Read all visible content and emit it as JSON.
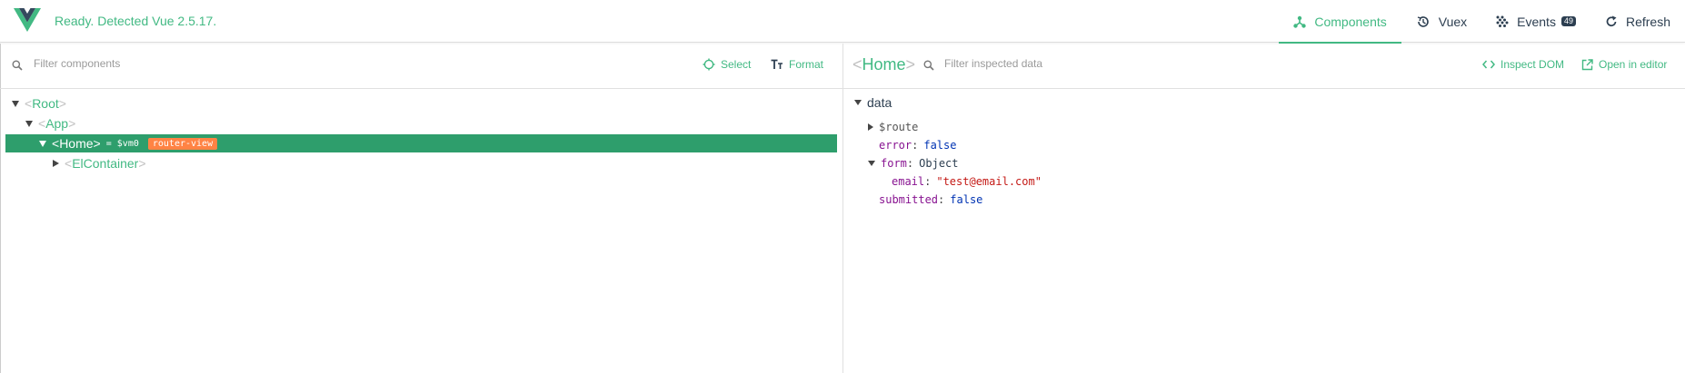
{
  "header": {
    "status": "Ready. Detected Vue 2.5.17.",
    "nav": {
      "components": "Components",
      "vuex": "Vuex",
      "events": "Events",
      "events_count": "49",
      "refresh": "Refresh"
    }
  },
  "left": {
    "filter_placeholder": "Filter components",
    "select_label": "Select",
    "format_label": "Format",
    "tree": {
      "root": "Root",
      "app": "App",
      "home": "Home",
      "home_vm": "= $vm0",
      "home_badge": "router-view",
      "container": "ElContainer"
    }
  },
  "right": {
    "title": "Home",
    "filter_placeholder": "Filter inspected data",
    "inspect_dom": "Inspect DOM",
    "open_editor": "Open in editor",
    "section": "data",
    "rows": {
      "route_key": "$route",
      "error_key": "error",
      "error_val": "false",
      "form_key": "form",
      "form_val": "Object",
      "email_key": "email",
      "email_val": "\"test@email.com\"",
      "submitted_key": "submitted",
      "submitted_val": "false"
    }
  },
  "colors": {
    "accent": "#42b983",
    "selected_row": "#2e9e6c",
    "badge": "#ff8344"
  }
}
